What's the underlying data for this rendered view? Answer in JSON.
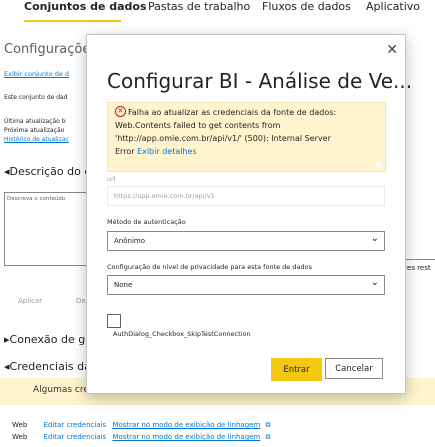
{
  "tabs": [
    "Conjuntos de dados",
    "Pastas de trabalho",
    "Fluxos de dados",
    "Aplicativo"
  ],
  "background": {
    "title": "Configuraçõe",
    "view_dataset_link": "Exibir conjunto de d",
    "dataset_note": "Este conjunto de dad",
    "last_update": "Última atualização b",
    "next_update": "Próxima atualização",
    "history_link": "Histórico de atualizaç",
    "description_section": "Descrição do c",
    "description_placeholder": "Descreva o conteúdo",
    "apply_button": "Aplicar",
    "discard_button": "De",
    "gateway_section": "Conexão de ga",
    "credentials_section": "Credenciais da f",
    "banner_text": "Algumas cre",
    "right_fragment": "eres rest",
    "credential_rows": [
      {
        "type": "Web",
        "edit": "Editar credenciais",
        "lineage": "Mostrar no modo de exibição de linhagem"
      },
      {
        "type": "Web",
        "edit": "Editar credenciais",
        "lineage": "Mostrar no modo de exibição de linhagem"
      }
    ]
  },
  "dialog": {
    "title": "Configurar BI - Análise de Ve...",
    "error_lines": [
      "Falha ao atualizar as credenciais da fonte de dados:",
      "Web.Contents failed to get contents from",
      "'http://app.omie.com.br/api/v1/' (500): Internal Server",
      "Error"
    ],
    "error_details_link": "Exibir detalhes",
    "url_label": "url",
    "url_value": "https://app.omie.com.br/api/v1",
    "auth_label": "Método de autenticação",
    "auth_value": "Anônimo",
    "privacy_label": "Configuração de nível de privacidade para esta fonte de dados",
    "privacy_value": "None",
    "checkbox_label": "AuthDialog_Checkbox_SkipTestConnection",
    "signin_button": "Entrar",
    "cancel_button": "Cancelar"
  },
  "colors": {
    "accent": "#f2c811",
    "link": "#0078d4",
    "warning_bg": "#fff4ce"
  }
}
